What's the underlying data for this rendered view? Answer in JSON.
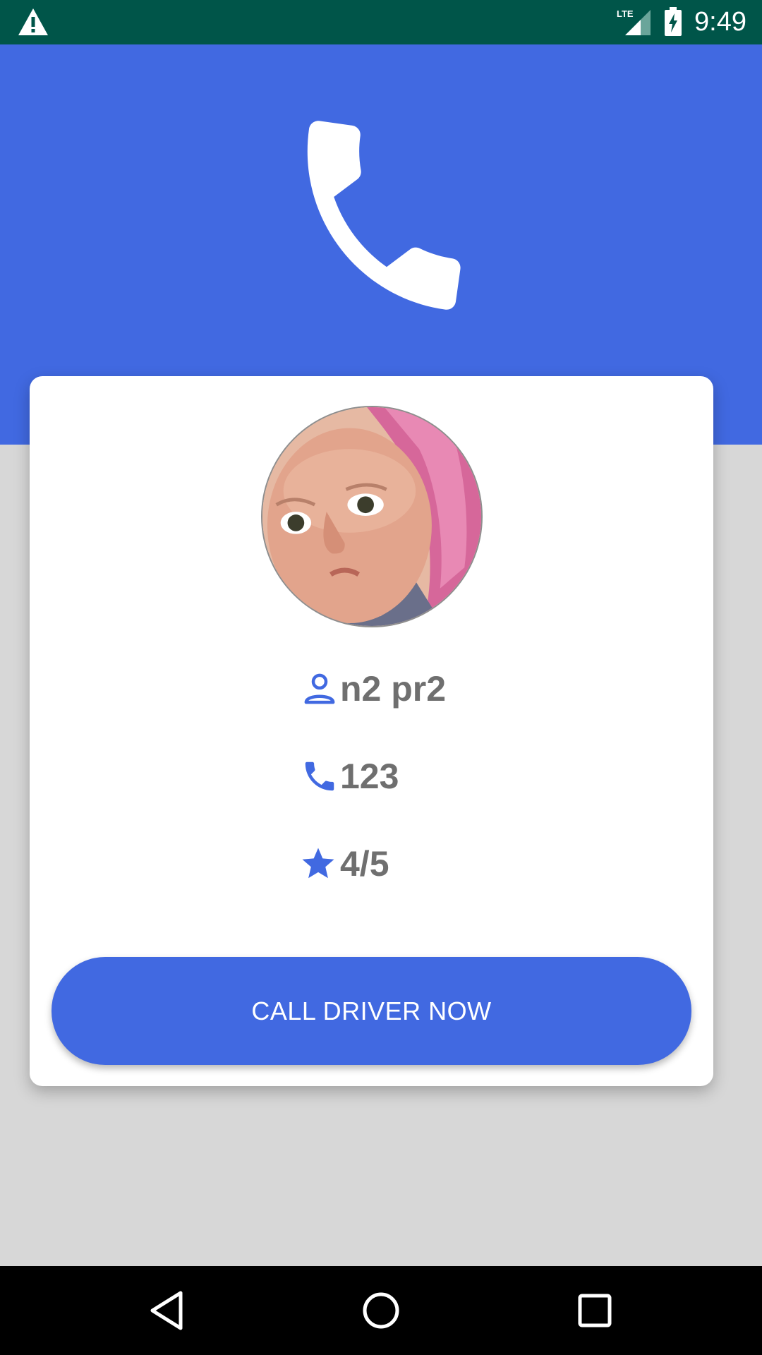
{
  "status_bar": {
    "time": "9:49",
    "network_label": "LTE",
    "icons": [
      "warning-icon",
      "signal-icon",
      "battery-charging-icon"
    ]
  },
  "hero": {
    "icon": "phone-icon",
    "background_color": "#4169e1"
  },
  "driver_card": {
    "avatar": "driver-photo",
    "name": "n2 pr2",
    "phone": "123",
    "rating": "4/5",
    "name_icon": "person-outline-icon",
    "phone_icon": "phone-icon",
    "rating_icon": "star-icon"
  },
  "call_button": {
    "label": "CALL DRIVER NOW"
  },
  "nav_bar": {
    "icons": [
      "back-icon",
      "home-icon",
      "recents-icon"
    ]
  },
  "colors": {
    "accent": "#4169e1",
    "status_bar": "#005549",
    "page_background": "#d7d7d7",
    "text": "#6f6f6f"
  }
}
